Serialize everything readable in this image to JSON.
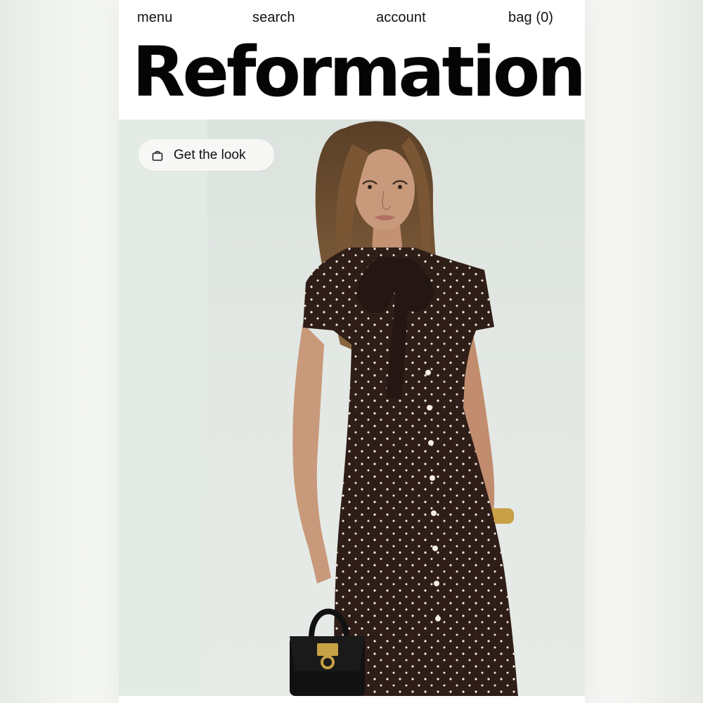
{
  "nav": {
    "menu": "menu",
    "search": "search",
    "account": "account",
    "bag": "bag (0)"
  },
  "brand": {
    "logo": "Reformation"
  },
  "hero": {
    "cta_label": "Get the look",
    "cta_icon": "shopping-bag-icon",
    "image_subject": "model-in-polka-dot-dress",
    "colors": {
      "backdrop": "#e3e8e4",
      "dress": "#2f1d17",
      "dots": "#f2ece6",
      "hair": "#6a4a2c",
      "skin": "#c79674",
      "handbag": "#111111",
      "accent_gold": "#c8a046"
    }
  }
}
